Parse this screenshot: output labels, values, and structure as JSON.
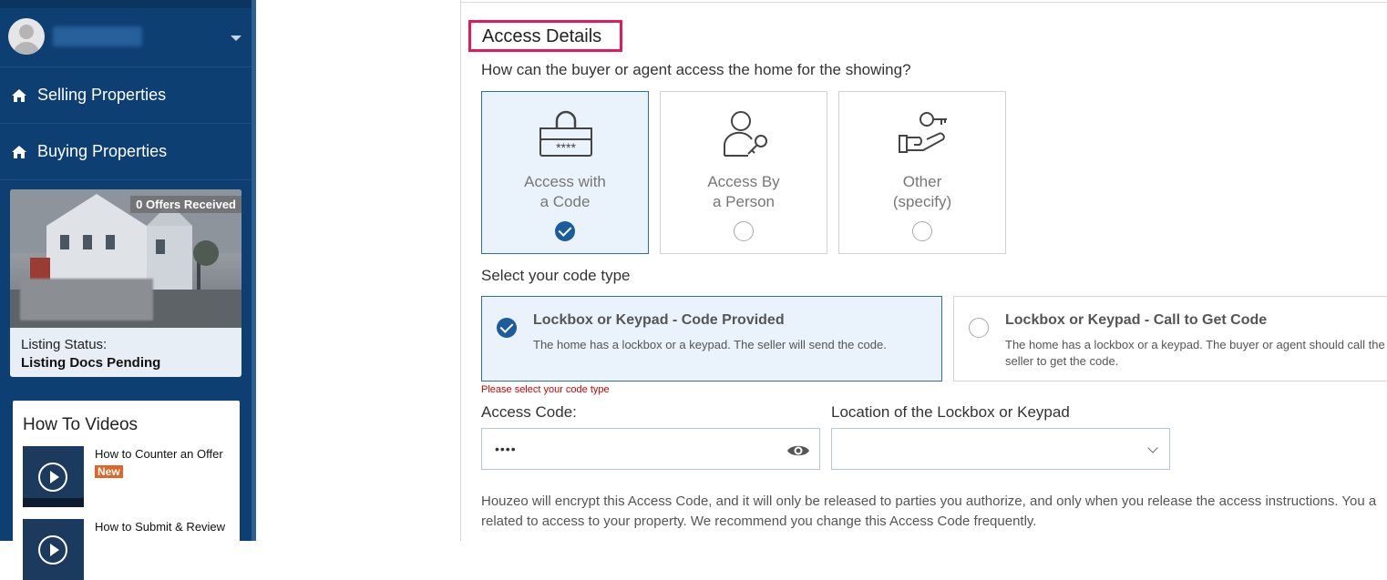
{
  "sidebar": {
    "nav": [
      {
        "label": "Selling Properties",
        "icon": "home-icon"
      },
      {
        "label": "Buying Properties",
        "icon": "home-icon"
      }
    ],
    "listing": {
      "offers_badge": "0 Offers Received",
      "status_label": "Listing Status:",
      "status_value": "Listing Docs Pending"
    },
    "videos": {
      "title": "How To Videos",
      "items": [
        {
          "title": "How to Counter an Offer",
          "badge": "New"
        },
        {
          "title": "How to Submit & Review"
        }
      ]
    }
  },
  "main": {
    "section_title": "Access Details",
    "question": "How can the buyer or agent access the home for the showing?",
    "access_options": [
      {
        "line1": "Access with",
        "line2": "a Code",
        "icon": "keypad-lock-icon",
        "selected": true
      },
      {
        "line1": "Access By",
        "line2": "a Person",
        "icon": "person-key-icon",
        "selected": false
      },
      {
        "line1": "Other",
        "line2": "(specify)",
        "icon": "hand-key-icon",
        "selected": false
      }
    ],
    "code_type_label": "Select your code type",
    "code_types": [
      {
        "title": "Lockbox or Keypad - Code Provided",
        "desc": "The home has a lockbox or a keypad. The seller will send the code.",
        "selected": true
      },
      {
        "title": "Lockbox or Keypad - Call to Get Code",
        "desc": "The home has a lockbox or a keypad. The buyer or agent should call the seller to get the code.",
        "selected": false
      }
    ],
    "error": "Please select your code type",
    "access_code_label": "Access Code:",
    "access_code_value": "••••",
    "location_label": "Location of the Lockbox or Keypad",
    "location_value": "",
    "note_line1": "Houzeo will encrypt this Access Code, and it will only be released to parties you authorize, and only when you release the access instructions. You a",
    "note_line2": "related to access to your property. We recommend you change this Access Code frequently."
  },
  "colors": {
    "sidebar": "#0e3f73",
    "accent": "#1a5c9c",
    "highlight_border": "#e3195a",
    "error": "#d40000",
    "badge": "#e0652a"
  }
}
